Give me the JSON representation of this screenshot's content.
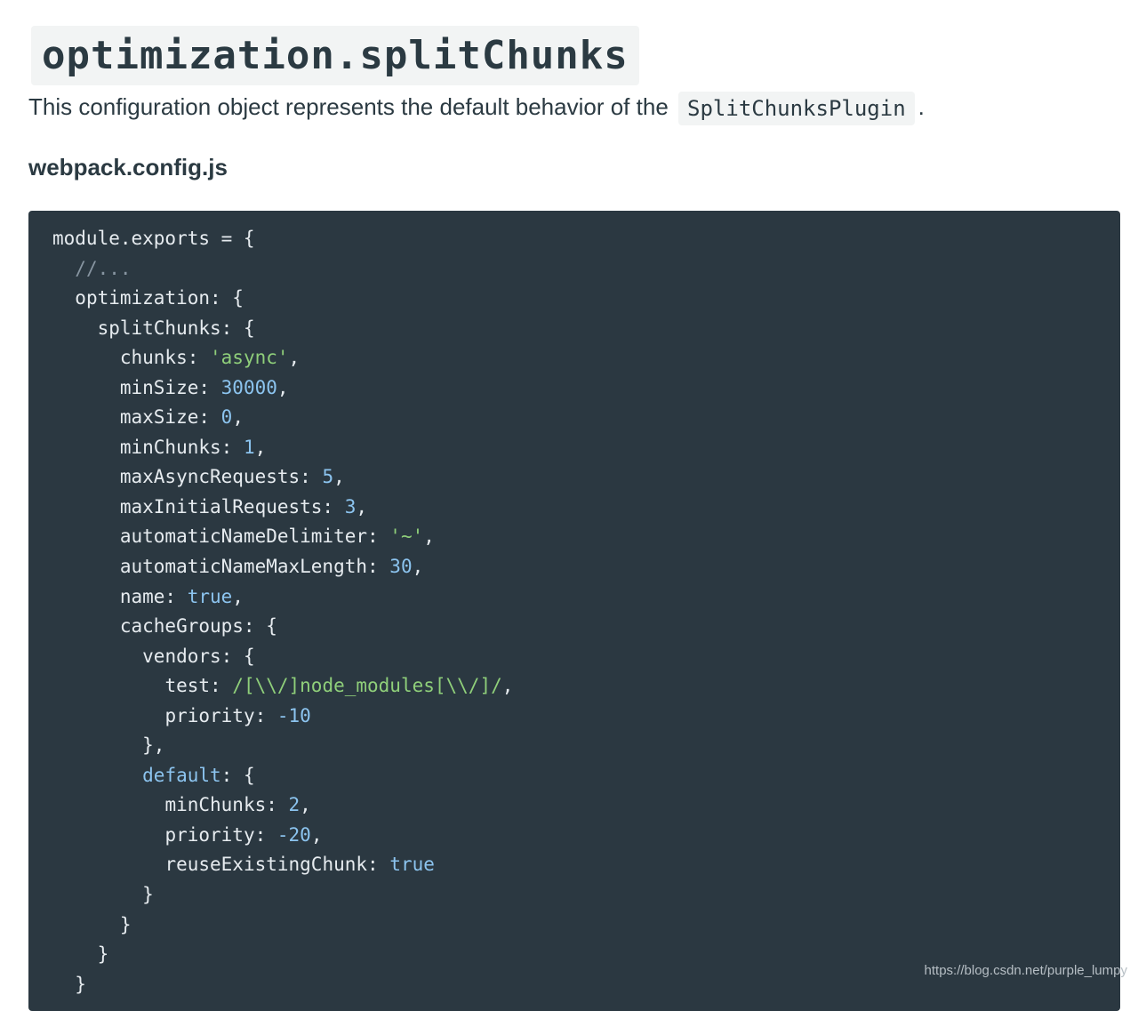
{
  "heading": {
    "text": "optimization.splitChunks"
  },
  "intro": {
    "text_before": "This configuration object represents the default behavior of the",
    "inline_code": "SplitChunksPlugin",
    "text_after": "."
  },
  "filename": {
    "text": "webpack.config.js"
  },
  "code": {
    "lines": [
      {
        "indent": "",
        "tokens": [
          {
            "t": "plain",
            "v": "module.exports = {"
          }
        ]
      },
      {
        "indent": "  ",
        "tokens": [
          {
            "t": "comment",
            "v": "//..."
          }
        ]
      },
      {
        "indent": "  ",
        "tokens": [
          {
            "t": "plain",
            "v": "optimization: {"
          }
        ]
      },
      {
        "indent": "    ",
        "tokens": [
          {
            "t": "plain",
            "v": "splitChunks: {"
          }
        ]
      },
      {
        "indent": "      ",
        "tokens": [
          {
            "t": "plain",
            "v": "chunks: "
          },
          {
            "t": "string",
            "v": "'async'"
          },
          {
            "t": "plain",
            "v": ","
          }
        ]
      },
      {
        "indent": "      ",
        "tokens": [
          {
            "t": "plain",
            "v": "minSize: "
          },
          {
            "t": "number",
            "v": "30000"
          },
          {
            "t": "plain",
            "v": ","
          }
        ]
      },
      {
        "indent": "      ",
        "tokens": [
          {
            "t": "plain",
            "v": "maxSize: "
          },
          {
            "t": "number",
            "v": "0"
          },
          {
            "t": "plain",
            "v": ","
          }
        ]
      },
      {
        "indent": "      ",
        "tokens": [
          {
            "t": "plain",
            "v": "minChunks: "
          },
          {
            "t": "number",
            "v": "1"
          },
          {
            "t": "plain",
            "v": ","
          }
        ]
      },
      {
        "indent": "      ",
        "tokens": [
          {
            "t": "plain",
            "v": "maxAsyncRequests: "
          },
          {
            "t": "number",
            "v": "5"
          },
          {
            "t": "plain",
            "v": ","
          }
        ]
      },
      {
        "indent": "      ",
        "tokens": [
          {
            "t": "plain",
            "v": "maxInitialRequests: "
          },
          {
            "t": "number",
            "v": "3"
          },
          {
            "t": "plain",
            "v": ","
          }
        ]
      },
      {
        "indent": "      ",
        "tokens": [
          {
            "t": "plain",
            "v": "automaticNameDelimiter: "
          },
          {
            "t": "string",
            "v": "'~'"
          },
          {
            "t": "plain",
            "v": ","
          }
        ]
      },
      {
        "indent": "      ",
        "tokens": [
          {
            "t": "plain",
            "v": "automaticNameMaxLength: "
          },
          {
            "t": "number",
            "v": "30"
          },
          {
            "t": "plain",
            "v": ","
          }
        ]
      },
      {
        "indent": "      ",
        "tokens": [
          {
            "t": "plain",
            "v": "name: "
          },
          {
            "t": "keyword",
            "v": "true"
          },
          {
            "t": "plain",
            "v": ","
          }
        ]
      },
      {
        "indent": "      ",
        "tokens": [
          {
            "t": "plain",
            "v": "cacheGroups: {"
          }
        ]
      },
      {
        "indent": "        ",
        "tokens": [
          {
            "t": "plain",
            "v": "vendors: {"
          }
        ]
      },
      {
        "indent": "          ",
        "tokens": [
          {
            "t": "plain",
            "v": "test: "
          },
          {
            "t": "string",
            "v": "/[\\\\/]node_modules[\\\\/]/"
          },
          {
            "t": "plain",
            "v": ","
          }
        ]
      },
      {
        "indent": "          ",
        "tokens": [
          {
            "t": "plain",
            "v": "priority: "
          },
          {
            "t": "number",
            "v": "-10"
          }
        ]
      },
      {
        "indent": "        ",
        "tokens": [
          {
            "t": "plain",
            "v": "},"
          }
        ]
      },
      {
        "indent": "        ",
        "tokens": [
          {
            "t": "keyword",
            "v": "default"
          },
          {
            "t": "plain",
            "v": ": {"
          }
        ]
      },
      {
        "indent": "          ",
        "tokens": [
          {
            "t": "plain",
            "v": "minChunks: "
          },
          {
            "t": "number",
            "v": "2"
          },
          {
            "t": "plain",
            "v": ","
          }
        ]
      },
      {
        "indent": "          ",
        "tokens": [
          {
            "t": "plain",
            "v": "priority: "
          },
          {
            "t": "number",
            "v": "-20"
          },
          {
            "t": "plain",
            "v": ","
          }
        ]
      },
      {
        "indent": "          ",
        "tokens": [
          {
            "t": "plain",
            "v": "reuseExistingChunk: "
          },
          {
            "t": "keyword",
            "v": "true"
          }
        ]
      },
      {
        "indent": "        ",
        "tokens": [
          {
            "t": "plain",
            "v": "}"
          }
        ]
      },
      {
        "indent": "      ",
        "tokens": [
          {
            "t": "plain",
            "v": "}"
          }
        ]
      },
      {
        "indent": "    ",
        "tokens": [
          {
            "t": "plain",
            "v": "}"
          }
        ]
      },
      {
        "indent": "  ",
        "tokens": [
          {
            "t": "plain",
            "v": "}"
          }
        ]
      }
    ]
  },
  "watermark": {
    "text": "https://blog.csdn.net/purple_lumpy"
  },
  "colors": {
    "code_background": "#2b3841",
    "code_text": "#e6ebef",
    "comment": "#8795a1",
    "string": "#8fcf7a",
    "number": "#8cc4ef",
    "keyword": "#8cc4ef",
    "heading_background": "#f2f4f4",
    "body_text": "#2b3a42"
  }
}
